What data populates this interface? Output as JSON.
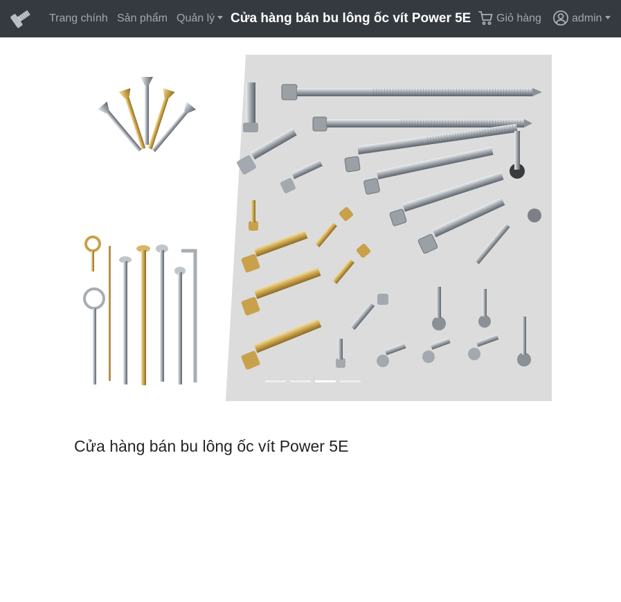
{
  "navbar": {
    "logo_icon": "screw-logo-icon",
    "links": {
      "home": "Trang chính",
      "products": "Sản phẩm",
      "manage": "Quản lý"
    },
    "brand": "Cửa hàng bán bu lông ốc vít Power 5E",
    "cart": {
      "icon": "cart-icon",
      "label": "Giỏ hàng"
    },
    "user": {
      "icon": "user-circle-icon",
      "label": "admin"
    },
    "colors": {
      "background": "#343a40",
      "link": "rgba(255,255,255,0.55)",
      "brand": "#ffffff"
    }
  },
  "carousel": {
    "slide_count": 4,
    "active_index": 2,
    "image_alt": "screws and bolts"
  },
  "main": {
    "title": "Cửa hàng bán bu lông ốc vít Power 5E"
  }
}
